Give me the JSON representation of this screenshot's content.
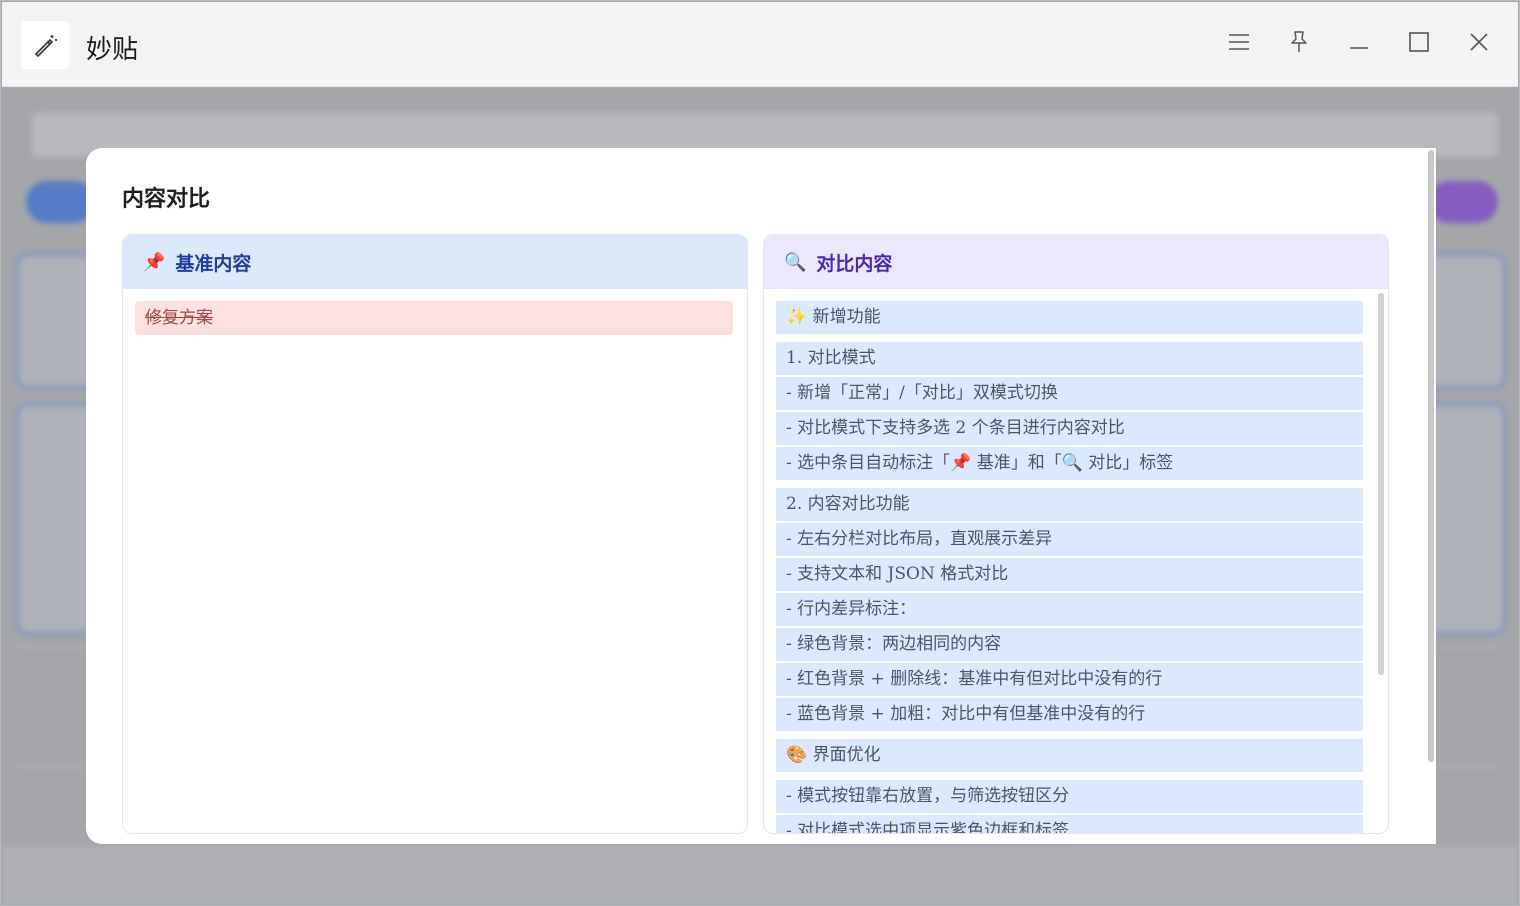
{
  "window": {
    "title": "妙贴",
    "controls": {
      "menu": "menu-icon",
      "pin": "pin-icon",
      "minimize": "minimize-icon",
      "maximize": "maximize-icon",
      "close": "close-icon"
    }
  },
  "modal": {
    "title": "内容对比",
    "left_panel": {
      "icon": "📌",
      "title": "基准内容",
      "lines": [
        "修复方案"
      ]
    },
    "right_panel": {
      "icon": "🔍",
      "title": "对比内容",
      "lines": [
        "✨ 新增功能",
        "1. 对比模式",
        "- 新增「正常」/「对比」双模式切换",
        "- 对比模式下支持多选 2 个条目进行内容对比",
        "- 选中条目自动标注「📌 基准」和「🔍 对比」标签",
        "2. 内容对比功能",
        "- 左右分栏对比布局，直观展示差异",
        "- 支持文本和 JSON 格式对比",
        "- 行内差异标注：",
        "- 绿色背景：两边相同的内容",
        "- 红色背景 + 删除线：基准中有但对比中没有的行",
        "- 蓝色背景 + 加粗：对比中有但基准中没有的行",
        "🎨 界面优化",
        "- 模式按钮靠右放置，与筛选按钮区分",
        "- 对比模式选中项显示紫色边框和标签"
      ]
    }
  },
  "colors": {
    "left_header_bg": "#dce9fb",
    "right_header_bg": "#ece6fb",
    "deleted_bg": "#fde0e0",
    "added_bg": "#dce8fd"
  }
}
